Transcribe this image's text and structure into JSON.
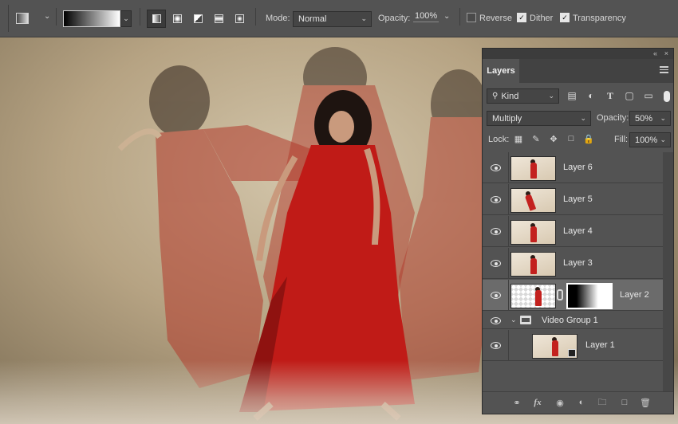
{
  "options_bar": {
    "tool_icon": "gradient-tool-preset-icon",
    "gradient_types": [
      "linear",
      "radial",
      "angle",
      "reflected",
      "diamond"
    ],
    "active_gradient_type": "linear",
    "mode_label": "Mode:",
    "mode_value": "Normal",
    "opacity_label": "Opacity:",
    "opacity_value": "100%",
    "reverse_label": "Reverse",
    "reverse_checked": false,
    "dither_label": "Dither",
    "dither_checked": true,
    "transparency_label": "Transparency",
    "transparency_checked": true
  },
  "canvas": {
    "description_colors": {
      "dress": "#c3211e",
      "background": "#c9b99c"
    }
  },
  "layers_panel": {
    "tab_label": "Layers",
    "filter_value": "Kind",
    "blend_mode": "Multiply",
    "opacity_label": "Opacity:",
    "opacity_value": "50%",
    "lock_label": "Lock:",
    "fill_label": "Fill:",
    "fill_value": "100%",
    "layers": [
      {
        "name": "Layer 6",
        "visible": true,
        "selected": false
      },
      {
        "name": "Layer 5",
        "visible": true,
        "selected": false
      },
      {
        "name": "Layer 4",
        "visible": true,
        "selected": false
      },
      {
        "name": "Layer 3",
        "visible": true,
        "selected": false
      },
      {
        "name": "Layer 2",
        "visible": true,
        "selected": true,
        "has_mask": true
      }
    ],
    "group": {
      "name": "Video Group 1",
      "expanded": true
    },
    "group_layers": [
      {
        "name": "Layer 1",
        "visible": true
      }
    ]
  }
}
